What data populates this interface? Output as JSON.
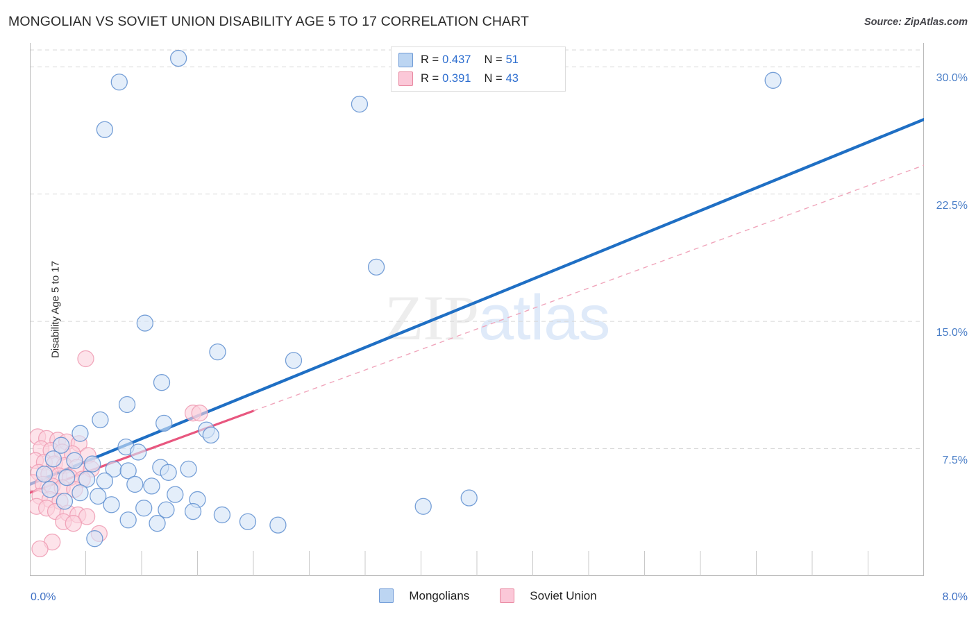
{
  "header": {
    "title": "MONGOLIAN VS SOVIET UNION DISABILITY AGE 5 TO 17 CORRELATION CHART",
    "source": "Source: ZipAtlas.com"
  },
  "watermark": {
    "part1": "ZIP",
    "part2": "atlas"
  },
  "stat_legend": {
    "rows": [
      {
        "color_key": "blue",
        "r_label": "R =",
        "r_value": "0.437",
        "n_label": "N =",
        "n_value": "51"
      },
      {
        "color_key": "pink",
        "r_label": "R =",
        "r_value": "0.391",
        "n_label": "N =",
        "n_value": "43"
      }
    ]
  },
  "series_legend": {
    "items": [
      {
        "label": "Mongolians",
        "color": "#bcd5f2"
      },
      {
        "label": "Soviet Union",
        "color": "#fbc8d8"
      }
    ]
  },
  "colors": {
    "blue_fill": "#d3e3f7",
    "blue_stroke": "#5f8fd0",
    "pink_fill": "#fbd2dd",
    "pink_stroke": "#ef9bb3",
    "blue_line": "#1f6fc4",
    "pink_line": "#e8577f",
    "pink_dash": "#f0a5bb",
    "grid": "#d8d8d8",
    "axis": "#b9b9b9",
    "tick_text": "#3d6fc4"
  },
  "chart_data": {
    "type": "scatter",
    "title": "MONGOLIAN VS SOVIET UNION DISABILITY AGE 5 TO 17 CORRELATION CHART",
    "xlabel": "",
    "ylabel": "Disability Age 5 to 17",
    "xlim": [
      0.0,
      8.0
    ],
    "ylim": [
      0.0,
      31.4
    ],
    "x_unit": "%",
    "y_unit": "%",
    "grid": true,
    "y_axis_side": "right",
    "x_ticks": [
      "0.0%",
      "8.0%"
    ],
    "x_tick_values": [
      0.0,
      8.0
    ],
    "y_ticks": [
      "7.5%",
      "15.0%",
      "22.5%",
      "30.0%"
    ],
    "y_tick_values": [
      7.5,
      15.0,
      22.5,
      30.0
    ],
    "legend_position": "bottom-center",
    "series": [
      {
        "name": "Mongolians",
        "color": "#bcd5f2",
        "r": 0.437,
        "n": 51,
        "trendline": {
          "style": "solid",
          "color": "#1f6fc4",
          "x0": 0.0,
          "y0": 5.4,
          "x1": 8.0,
          "y1": 26.9
        },
        "points": [
          [
            1.33,
            30.5
          ],
          [
            0.8,
            29.1
          ],
          [
            6.65,
            29.2
          ],
          [
            2.95,
            27.8
          ],
          [
            0.67,
            26.3
          ],
          [
            3.1,
            18.2
          ],
          [
            1.03,
            14.9
          ],
          [
            1.68,
            13.2
          ],
          [
            2.36,
            12.7
          ],
          [
            1.18,
            11.4
          ],
          [
            0.87,
            10.1
          ],
          [
            0.63,
            9.2
          ],
          [
            1.2,
            9.0
          ],
          [
            0.45,
            8.4
          ],
          [
            1.58,
            8.6
          ],
          [
            1.62,
            8.3
          ],
          [
            0.28,
            7.7
          ],
          [
            0.86,
            7.6
          ],
          [
            0.97,
            7.3
          ],
          [
            0.21,
            6.9
          ],
          [
            0.4,
            6.8
          ],
          [
            0.56,
            6.6
          ],
          [
            0.75,
            6.3
          ],
          [
            0.88,
            6.2
          ],
          [
            1.17,
            6.4
          ],
          [
            1.24,
            6.1
          ],
          [
            1.42,
            6.3
          ],
          [
            0.13,
            6.0
          ],
          [
            0.33,
            5.8
          ],
          [
            0.51,
            5.7
          ],
          [
            0.67,
            5.6
          ],
          [
            0.94,
            5.4
          ],
          [
            1.09,
            5.3
          ],
          [
            0.18,
            5.1
          ],
          [
            0.45,
            4.9
          ],
          [
            0.61,
            4.7
          ],
          [
            1.3,
            4.8
          ],
          [
            1.5,
            4.5
          ],
          [
            0.31,
            4.4
          ],
          [
            0.73,
            4.2
          ],
          [
            1.02,
            4.0
          ],
          [
            1.22,
            3.9
          ],
          [
            1.46,
            3.8
          ],
          [
            1.72,
            3.6
          ],
          [
            0.88,
            3.3
          ],
          [
            1.14,
            3.1
          ],
          [
            1.95,
            3.2
          ],
          [
            2.22,
            3.0
          ],
          [
            0.58,
            2.2
          ],
          [
            3.52,
            4.1
          ],
          [
            3.93,
            4.6
          ]
        ]
      },
      {
        "name": "Soviet Union",
        "color": "#fbc8d8",
        "r": 0.391,
        "n": 43,
        "trendline": {
          "style": "solid-then-dashed",
          "color": "#e8577f",
          "dash_color": "#f0a5bb",
          "x0": 0.0,
          "y0": 4.9,
          "x1": 8.0,
          "y1": 24.2,
          "solid_until_x": 2.0
        },
        "points": [
          [
            0.5,
            12.8
          ],
          [
            1.46,
            9.6
          ],
          [
            1.52,
            9.6
          ],
          [
            0.07,
            8.2
          ],
          [
            0.15,
            8.1
          ],
          [
            0.25,
            8.0
          ],
          [
            0.33,
            7.9
          ],
          [
            0.44,
            7.8
          ],
          [
            0.1,
            7.5
          ],
          [
            0.19,
            7.4
          ],
          [
            0.29,
            7.3
          ],
          [
            0.38,
            7.2
          ],
          [
            0.52,
            7.1
          ],
          [
            0.05,
            6.8
          ],
          [
            0.13,
            6.7
          ],
          [
            0.22,
            6.6
          ],
          [
            0.31,
            6.5
          ],
          [
            0.42,
            6.4
          ],
          [
            0.55,
            6.3
          ],
          [
            0.08,
            6.1
          ],
          [
            0.17,
            6.0
          ],
          [
            0.26,
            5.9
          ],
          [
            0.36,
            5.8
          ],
          [
            0.47,
            5.7
          ],
          [
            0.03,
            5.5
          ],
          [
            0.12,
            5.4
          ],
          [
            0.2,
            5.3
          ],
          [
            0.29,
            5.2
          ],
          [
            0.4,
            5.1
          ],
          [
            0.09,
            4.7
          ],
          [
            0.18,
            4.5
          ],
          [
            0.27,
            4.4
          ],
          [
            0.06,
            4.1
          ],
          [
            0.15,
            4.0
          ],
          [
            0.23,
            3.8
          ],
          [
            0.34,
            3.7
          ],
          [
            0.43,
            3.6
          ],
          [
            0.51,
            3.5
          ],
          [
            0.3,
            3.2
          ],
          [
            0.39,
            3.1
          ],
          [
            0.62,
            2.5
          ],
          [
            0.2,
            2.0
          ],
          [
            0.09,
            1.6
          ]
        ]
      }
    ]
  }
}
